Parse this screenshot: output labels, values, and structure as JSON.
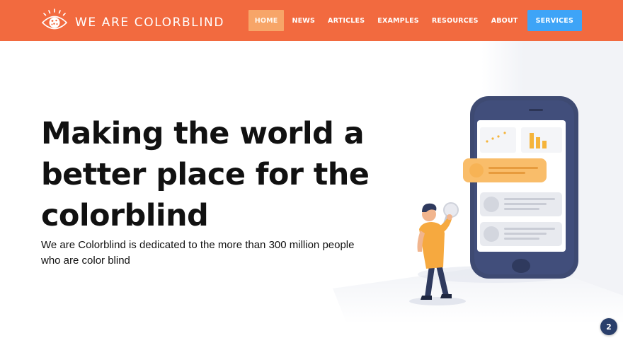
{
  "brand": {
    "name": "WE ARE COLORBLIND",
    "primary_color": "#f26a3f",
    "accent_color": "#3ea4f7",
    "logo_icon": "eye-icon"
  },
  "nav": {
    "items": [
      {
        "label": "HOME",
        "active": true
      },
      {
        "label": "NEWS"
      },
      {
        "label": "ARTICLES"
      },
      {
        "label": "EXAMPLES"
      },
      {
        "label": "RESOURCES"
      },
      {
        "label": "ABOUT"
      },
      {
        "label": "SERVICES",
        "highlight": true
      }
    ]
  },
  "hero": {
    "title": "Making the world a better place for the colorblind",
    "subtitle": "We are Colorblind is dedicated to the more than 300 million people who are color blind",
    "illustration": "person-with-smartphone-illustration"
  },
  "badge": {
    "count": "2"
  }
}
